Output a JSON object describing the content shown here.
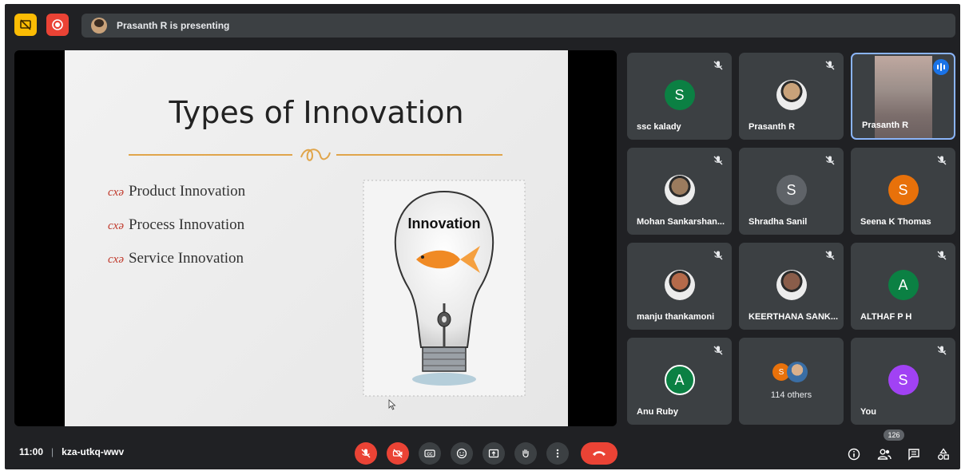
{
  "topbar": {
    "presenting_text": "Prasanth R is presenting"
  },
  "slide": {
    "title": "Types of Innovation",
    "bullets": [
      "Product Innovation",
      "Process Innovation",
      "Service Innovation"
    ],
    "image_caption": "Innovation"
  },
  "participants": [
    {
      "name": "ssc kalady",
      "initial": "S",
      "color": "#0b8043",
      "muted": true
    },
    {
      "name": "Prasanth R",
      "initial": "",
      "color": "#c9a27a",
      "muted": true,
      "photo": true
    },
    {
      "name": "Prasanth R",
      "initial": "",
      "color": "",
      "muted": false,
      "speaking": true,
      "video": true
    },
    {
      "name": "Mohan Sankarshan...",
      "initial": "",
      "color": "#9b7b5e",
      "muted": true,
      "photo": true
    },
    {
      "name": "Shradha Sanil",
      "initial": "S",
      "color": "#5f6368",
      "muted": true
    },
    {
      "name": "Seena K Thomas",
      "initial": "S",
      "color": "#e8710a",
      "muted": true
    },
    {
      "name": "manju thankamoni",
      "initial": "",
      "color": "#b56a4a",
      "muted": true,
      "photo": true
    },
    {
      "name": "KEERTHANA SANK...",
      "initial": "",
      "color": "#8a5d4a",
      "muted": true,
      "photo": true
    },
    {
      "name": "ALTHAF P H",
      "initial": "A",
      "color": "#0b8043",
      "muted": true
    },
    {
      "name": "Anu Ruby",
      "initial": "A",
      "color": "#0b8043",
      "muted": true
    },
    {
      "name": "",
      "initial": "",
      "color": "",
      "muted": false,
      "others_label": "114 others",
      "others_initial": "S"
    },
    {
      "name": "You",
      "initial": "S",
      "color": "#a142f4",
      "muted": true
    }
  ],
  "bottombar": {
    "time": "11:00",
    "separator": "|",
    "meeting_code": "kza-utkq-wwv",
    "participant_count": "126"
  },
  "colors": {
    "background": "#202124",
    "tile": "#3c4043",
    "danger": "#ea4335",
    "accent": "#8ab4f8"
  }
}
